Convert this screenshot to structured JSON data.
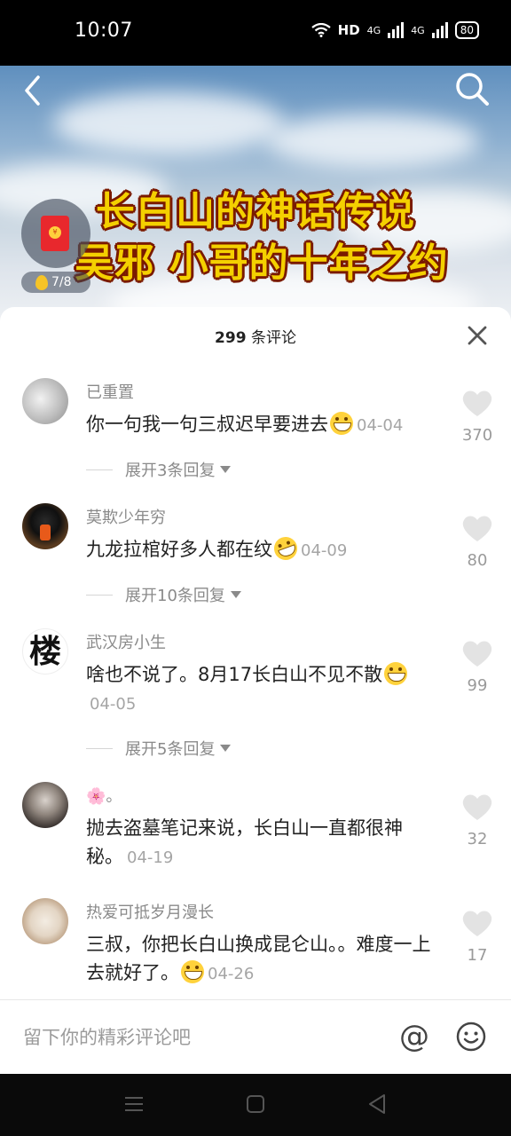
{
  "status_bar": {
    "time": "10:07",
    "hd_label": "HD",
    "net1": "4G",
    "net2": "4G",
    "battery": "80"
  },
  "video": {
    "title_line1": "长白山的神话传说",
    "title_line2": "吴邪 小哥的十年之约",
    "coin_progress": "7/8"
  },
  "comments_header": {
    "count": "299",
    "label": "条评论"
  },
  "comments": [
    {
      "username": "已重置",
      "text": "你一句我一句三叔迟早要进去",
      "emoji": "grin",
      "date": "04-04",
      "likes": "370",
      "expand": "展开3条回复"
    },
    {
      "username": "莫欺少年穷",
      "text": "九龙拉棺好多人都在纹",
      "emoji": "rofl",
      "date": "04-09",
      "likes": "80",
      "expand": "展开10条回复"
    },
    {
      "username": "武汉房小生",
      "text": "啥也不说了。8月17长白山不见不散",
      "emoji": "grin",
      "date": "04-05",
      "likes": "99",
      "expand": "展开5条回复",
      "avatar_char": "楼"
    },
    {
      "username": "🌸。",
      "text": "抛去盗墓笔记来说，长白山一直都很神秘。",
      "emoji": "",
      "date": "04-19",
      "likes": "32",
      "expand": ""
    },
    {
      "username": "热爱可抵岁月漫长",
      "text": "三叔，你把长白山换成昆仑山。。难度一上去就好了。",
      "emoji": "grin",
      "date": "04-26",
      "likes": "17",
      "expand": ""
    }
  ],
  "input_bar": {
    "placeholder": "留下你的精彩评论吧",
    "at_symbol": "@"
  },
  "icons": {
    "back": "chevron-left-icon",
    "search": "search-icon",
    "close": "close-icon",
    "like": "heart-icon",
    "emoji": "smiley-icon",
    "nav_menu": "menu-icon",
    "nav_home": "home-square-icon",
    "nav_back": "triangle-back-icon"
  },
  "colors": {
    "title_yellow": "#f4d000",
    "title_outline": "#7a1a00",
    "redpack": "#e8282d"
  }
}
